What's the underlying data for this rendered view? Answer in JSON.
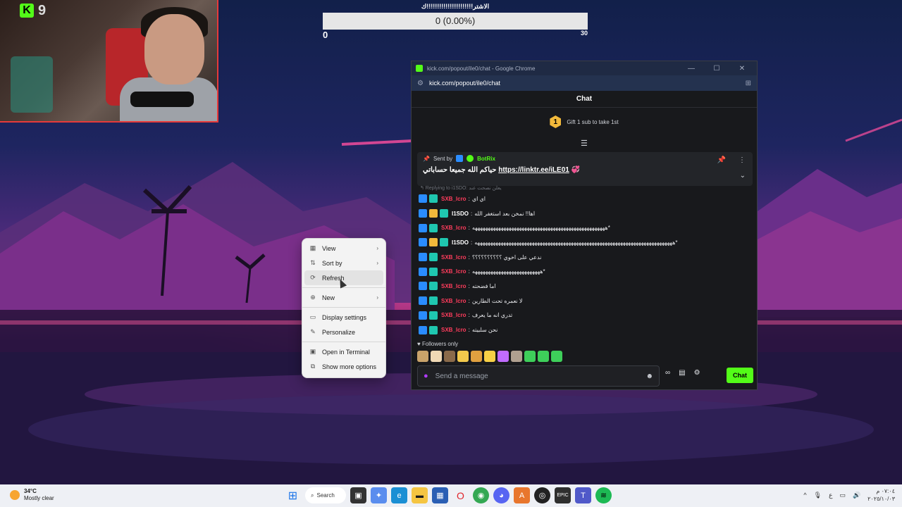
{
  "overlay": {
    "kick_badge_number": "9",
    "goal": {
      "title": "الاشتر!!!!!!!!!!!!!!!!!!!!!!ك",
      "progress_text": "0 (0.00%)",
      "min": "0",
      "max": "30",
      "progress_fraction": 0
    }
  },
  "chrome_window": {
    "title": "kick.com/popout/ile0/chat - Google Chrome",
    "url": "kick.com/popout/ile0/chat",
    "controls": {
      "minimize": "—",
      "maximize": "☐",
      "close": "✕"
    }
  },
  "chat": {
    "header": "Chat",
    "gift": {
      "rank": "1",
      "text": "Gift 1 sub to take 1st"
    },
    "pinned": {
      "sent_by_label": "Sent by",
      "bot_name": "BotRix",
      "message_prefix": "حياكم الله جميعا حساباتي",
      "link": "https://linktr.ee/iLE01",
      "suffix_emoji": "💞"
    },
    "reply_hint": "↰ Replying to i1SDO: يعلن نصحت عند",
    "messages": [
      {
        "badges": [
          "mod",
          "sub"
        ],
        "user": "SXB_lcro",
        "color": "red",
        "text": "اي اي"
      },
      {
        "badges": [
          "mod",
          "crown",
          "sub"
        ],
        "user": "I1SDO",
        "color": "white",
        "text": "اها!! نمخن بعد استغفر الله"
      },
      {
        "badges": [
          "mod",
          "sub"
        ],
        "user": "SXB_lcro",
        "color": "red",
        "text": "هههههههههههههههههههههههههههههههههههههههههههههههههههه*"
      },
      {
        "badges": [
          "mod",
          "crown",
          "sub"
        ],
        "user": "I1SDO",
        "color": "white",
        "text": "ههههههههههههههههههههههههههههههههههههههههههههههههههههههههههههههههههههههههههههه*"
      },
      {
        "badges": [
          "mod",
          "sub"
        ],
        "user": "SXB_lcro",
        "color": "red",
        "text": "ندعي على اخوي ؟؟؟؟؟؟؟؟؟؟"
      },
      {
        "badges": [
          "mod",
          "sub"
        ],
        "user": "SXB_lcro",
        "color": "red",
        "text": "ههههههههههههههههههههههههههه*"
      },
      {
        "badges": [
          "mod",
          "sub"
        ],
        "user": "SXB_lcro",
        "color": "red",
        "text": "اما فضحته"
      },
      {
        "badges": [
          "mod",
          "sub"
        ],
        "user": "SXB_lcro",
        "color": "red",
        "text": "لا نعمره تحت الطارين"
      },
      {
        "badges": [
          "mod",
          "sub"
        ],
        "user": "SXB_lcro",
        "color": "red",
        "text": "تدري انه ما يعرف"
      },
      {
        "badges": [
          "mod",
          "sub"
        ],
        "user": "SXB_lcro",
        "color": "red",
        "text": "نحن سلبيته"
      }
    ],
    "followers_only": "♥ Followers only",
    "emotes": [
      "#c9a36a",
      "#f0d9b5",
      "#8a6a4a",
      "#f2c94c",
      "#e0a040",
      "#f7d046",
      "#c06bff",
      "#b0a090",
      "#3ecf5a",
      "#3ecf5a",
      "#3ecf5a"
    ],
    "input_placeholder": "Send a message",
    "send_label": "Chat",
    "accent": "#53fc18"
  },
  "context_menu": {
    "items": [
      {
        "label": "View",
        "icon": "▦",
        "submenu": true
      },
      {
        "label": "Sort by",
        "icon": "⇅",
        "submenu": true
      },
      {
        "label": "Refresh",
        "icon": "⟳",
        "submenu": false
      },
      {
        "label": "New",
        "icon": "⊕",
        "submenu": true
      },
      {
        "label": "Display settings",
        "icon": "▭",
        "submenu": false
      },
      {
        "label": "Personalize",
        "icon": "✎",
        "submenu": false
      },
      {
        "label": "Open in Terminal",
        "icon": "▣",
        "submenu": false
      },
      {
        "label": "Show more options",
        "icon": "⧉",
        "submenu": false
      }
    ]
  },
  "taskbar": {
    "weather": {
      "temp": "34°C",
      "condition": "Mostly clear"
    },
    "search_label": "Search",
    "clock": {
      "time": "٠٧:٠٤ م",
      "date": "٢٠٢٥/١٠/٠٣"
    },
    "tray_lang": "ع"
  }
}
